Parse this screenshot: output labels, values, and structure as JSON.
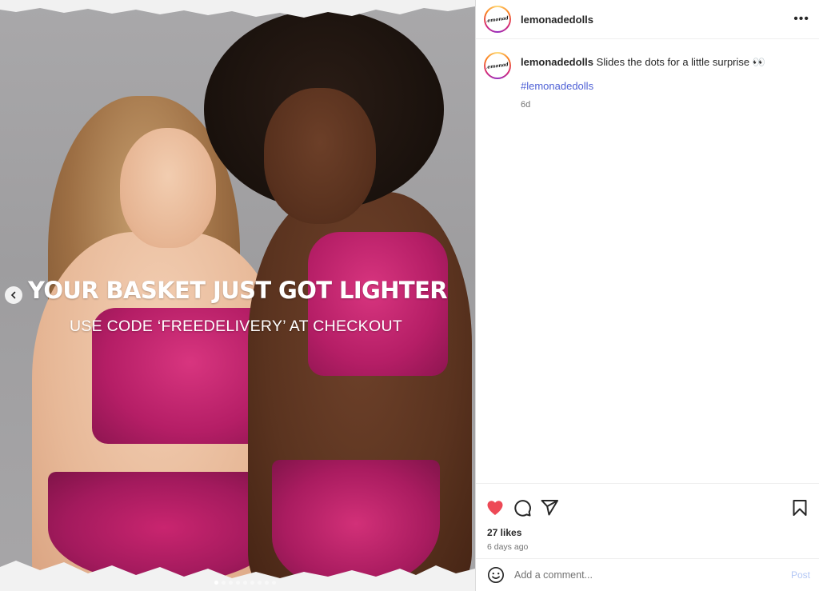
{
  "post": {
    "image": {
      "headline": "YOUR BASKET JUST GOT LIGHTER",
      "subline": "USE CODE ‘FREEDELIVERY’ AT CHECKOUT",
      "carousel_dots": 9,
      "active_dot": 0
    },
    "author": {
      "username": "lemonadedolls",
      "avatar_text": "Lemonade"
    },
    "caption": {
      "username": "lemonadedolls",
      "text": "Slides the dots for a little surprise 👀",
      "hashtag": "#lemonadedolls",
      "age": "6d"
    },
    "likes": "27 likes",
    "time_ago": "6 days ago",
    "comment": {
      "placeholder": "Add a comment...",
      "post_label": "Post"
    },
    "colors": {
      "like_red": "#ed4956",
      "link_blue": "#4f61d6",
      "post_disabled": "#b3c7f5",
      "lingerie_pink": "#b51e66"
    },
    "icons": {
      "more": "more-options-icon",
      "like": "heart-filled-icon",
      "comment": "comment-bubble-icon",
      "share": "paper-plane-icon",
      "save": "bookmark-icon",
      "emoji": "emoji-smile-icon",
      "prev": "chevron-left-icon"
    }
  }
}
